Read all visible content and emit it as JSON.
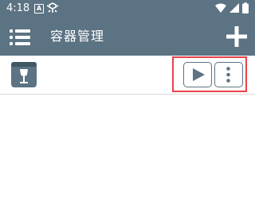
{
  "status_bar": {
    "time": "4:18",
    "a_badge": "A"
  },
  "app_bar": {
    "title": "容器管理",
    "menu_icon": "hamburger-menu-icon",
    "add_icon": "plus-icon"
  },
  "containers": [
    {
      "icon": "wine-glass-container-icon",
      "actions": {
        "run": "play-icon",
        "more": "more-vertical-icon"
      },
      "highlighted": true
    }
  ],
  "colors": {
    "primary": "#5b7383",
    "highlight": "#e8424a",
    "background": "#ffffff",
    "divider": "#d9d9d9"
  }
}
